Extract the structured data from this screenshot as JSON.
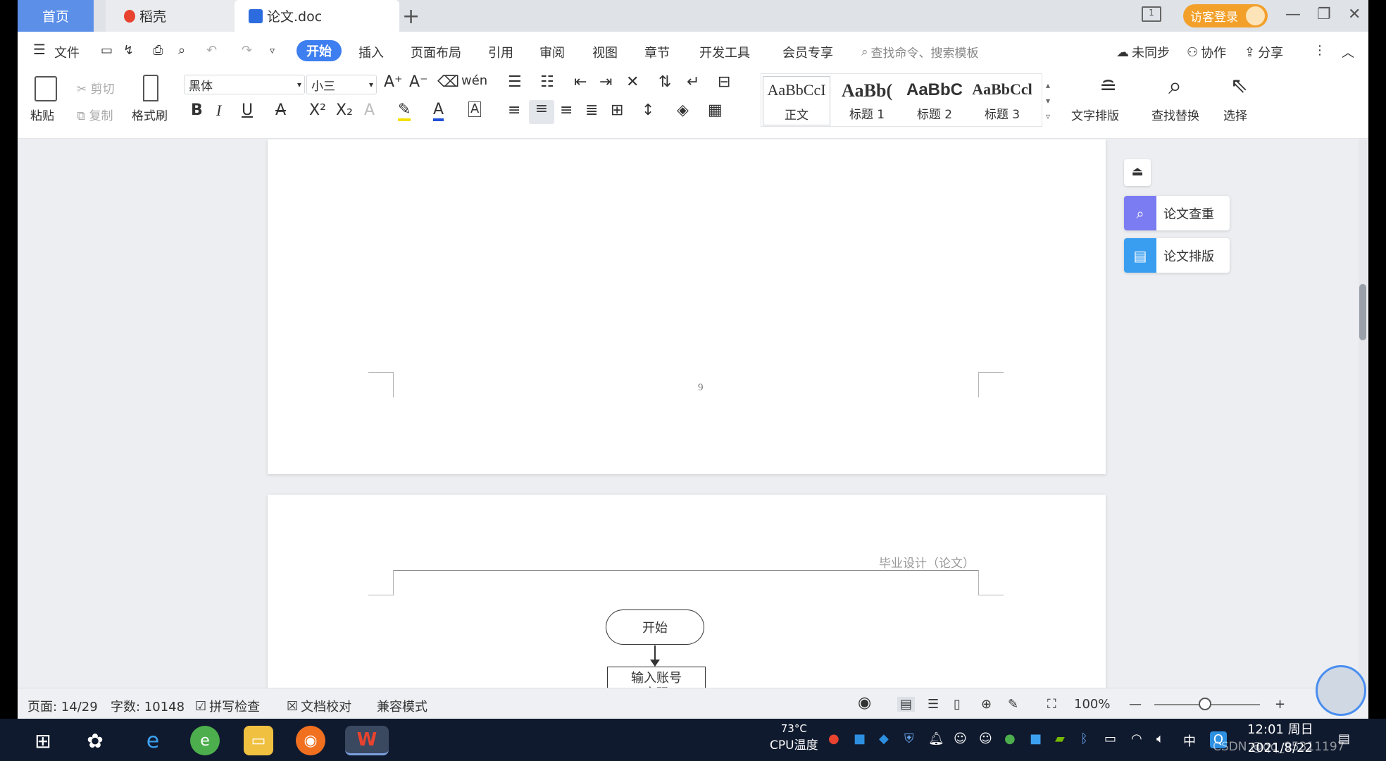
{
  "titlebar": {
    "home_tab": "首页",
    "daoke_tab": "稻壳",
    "doc_tab": "论文.doc",
    "login_label": "访客登录"
  },
  "menu": {
    "file": "文件",
    "items": [
      "开始",
      "插入",
      "页面布局",
      "引用",
      "审阅",
      "视图",
      "章节",
      "开发工具",
      "会员专享"
    ],
    "search_placeholder": "查找命令、搜索模板",
    "sync": "未同步",
    "collab": "协作",
    "share": "分享"
  },
  "ribbon": {
    "paste": "粘贴",
    "cut": "剪切",
    "copy": "复制",
    "format_painter": "格式刷",
    "font_name": "黑体",
    "font_size": "小三",
    "styles": [
      {
        "sample": "AaBbCcI",
        "name": "正文"
      },
      {
        "sample": "AaBb(",
        "name": "标题 1"
      },
      {
        "sample": "AaBbC",
        "name": "标题 2"
      },
      {
        "sample": "AaBbCcl",
        "name": "标题 3"
      }
    ],
    "text_layout": "文字排版",
    "find_replace": "查找替换",
    "select": "选择"
  },
  "document": {
    "page_number": "9",
    "header_text": "毕业设计（论文）",
    "flow_start": "开始",
    "flow_input_line1": "输入账号",
    "flow_input_line2": "密码"
  },
  "side_panel": {
    "check": "论文查重",
    "layout": "论文排版"
  },
  "status": {
    "page": "页面: 14/29",
    "words": "字数: 10148",
    "spell": "拼写检查",
    "proof": "文档校对",
    "compat": "兼容模式",
    "zoom": "100%"
  },
  "taskbar": {
    "cpu_temp": "73°C",
    "cpu_label": "CPU温度",
    "ime": "中",
    "time": "12:01 周日",
    "date": "2021/8/22",
    "watermark": "CSDN @qq_95311197"
  },
  "colors": {
    "accent": "#3d7ef0",
    "home_tab": "#5b8fe8",
    "login": "#f2a02a",
    "check_icon": "#7b7cf2",
    "layout_icon": "#3a9ef0"
  }
}
